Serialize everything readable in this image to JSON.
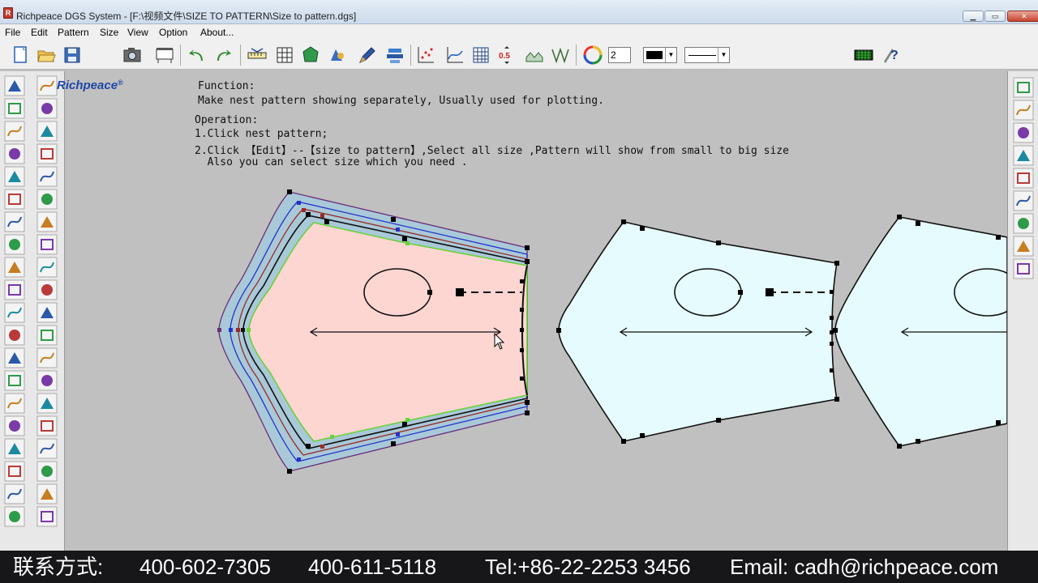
{
  "window": {
    "title": "Richpeace DGS System - [F:\\视频文件\\SIZE TO PATTERN\\Size to pattern.dgs]",
    "app_icon": "R",
    "controls": [
      "minimize-icon",
      "maximize-icon",
      "close-icon"
    ]
  },
  "menu": [
    "File",
    "Edit",
    "Pattern",
    "Size",
    "View",
    "Option",
    "About..."
  ],
  "toolbar": {
    "line_width_value": "2",
    "selected_tool": "richpeace-r-icon"
  },
  "brand": {
    "logo_text": "Richpeace",
    "registered_mark": "®"
  },
  "instructions": {
    "function_heading": "Function:",
    "function_text": "Make nest pattern showing separately, Usually used for plotting.",
    "operation_heading": "Operation:",
    "step1": "1.Click nest pattern;",
    "step2": "2.Click 【Edit】--【size to pattern】,Select all size ,Pattern will show from small to big size",
    "step3": "  Also you can select size which you need ."
  },
  "footer": {
    "contact_cn": "联系方式:",
    "phone1": "400-602-7305",
    "phone2": "400-611-5118",
    "tel": "Tel:+86-22-2253 3456",
    "email": "Email: cadh@richpeace.com"
  },
  "colors": {
    "nest_fill": "#fdd6d2",
    "pattern_fill": "#e6fbfd",
    "outer_band": "#a9c9d8",
    "accent_select": "#d42222"
  }
}
